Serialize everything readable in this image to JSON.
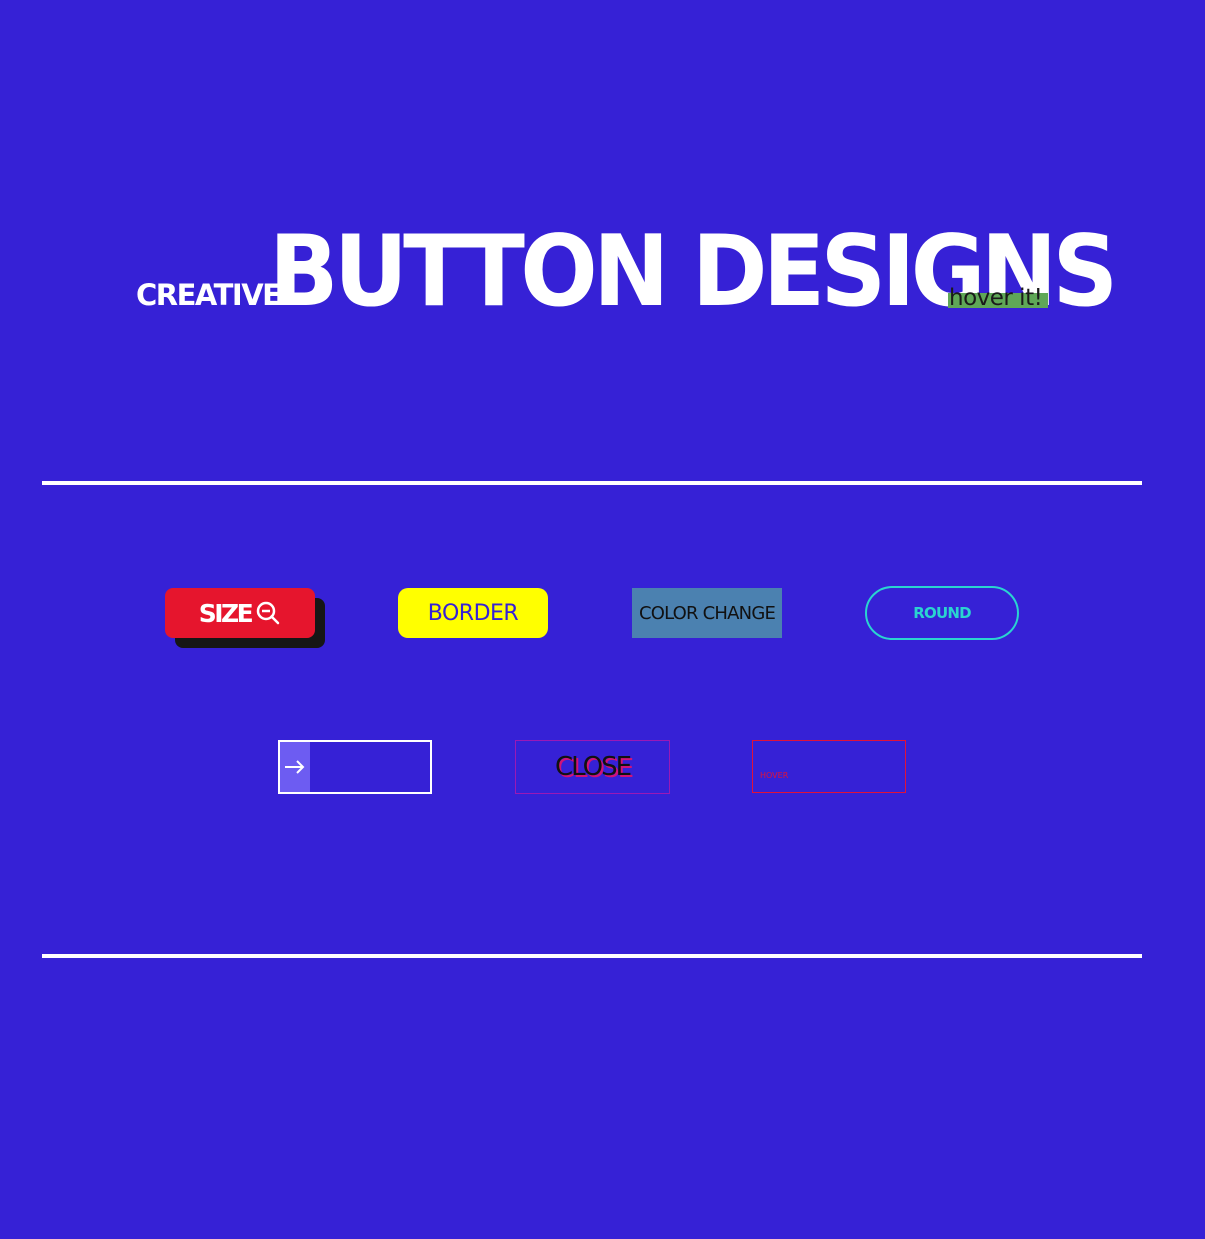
{
  "heading": {
    "prefix": "CREATIVE",
    "title": "BUTTON DESIGNS",
    "hint": "hover it!"
  },
  "buttons": {
    "size": {
      "label": "SIZE",
      "icon": "zoom-out-icon"
    },
    "border": {
      "label": "BORDER"
    },
    "color_change": {
      "label": "COLOR CHANGE"
    },
    "round": {
      "label": "ROUND"
    },
    "arrow": {
      "icon": "arrow-right-icon"
    },
    "close": {
      "label": "CLOSE"
    },
    "hover": {
      "label": "HOVER"
    }
  },
  "colors": {
    "background": "#3621d6",
    "size_button": "#e6152d",
    "border_button": "#ffff00",
    "color_change_button": "#4b81b0",
    "round_outline": "#2ad4d0",
    "hint_highlight": "#5fa757"
  }
}
